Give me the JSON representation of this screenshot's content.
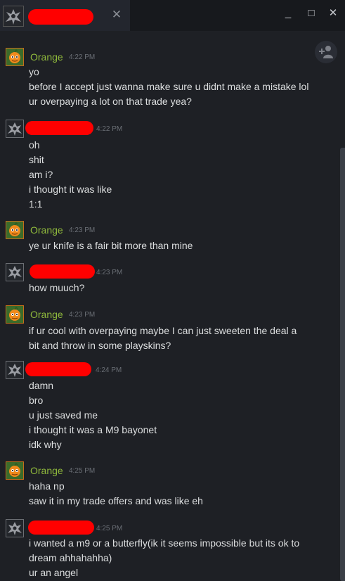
{
  "window": {
    "tab_close": "✕",
    "minimize": "_",
    "maximize": "□",
    "close": "✕"
  },
  "add_friend_icon": "person-plus-icon",
  "colors": {
    "accent_name": "#90ba3c",
    "redaction": "#ff0000",
    "background": "#1e2025"
  },
  "messages": [
    {
      "sender": "Orange",
      "time": "4:22 PM",
      "lines": [
        "yo",
        "before I accept just wanna make sure u didnt make a mistake lol",
        "ur overpaying a lot on that trade yea?"
      ]
    },
    {
      "sender": "",
      "time": "4:22 PM",
      "lines": [
        "oh",
        "shit",
        "am i?",
        "i thought it was like",
        "1:1"
      ]
    },
    {
      "sender": "Orange",
      "time": "4:23 PM",
      "lines": [
        "ye ur knife is a fair bit more than mine"
      ]
    },
    {
      "sender": "",
      "time": "4:23 PM",
      "lines": [
        "how muuch?"
      ]
    },
    {
      "sender": "Orange",
      "time": "4:23 PM",
      "lines": [
        "if ur cool with overpaying maybe I can just sweeten the deal a",
        "bit and throw in some playskins?"
      ]
    },
    {
      "sender": "",
      "time": "4:24 PM",
      "lines": [
        "damn",
        "bro",
        "u just saved me",
        "i thought it was a M9 bayonet",
        "idk why"
      ]
    },
    {
      "sender": "Orange",
      "time": "4:25 PM",
      "lines": [
        "haha np",
        "saw it in my trade offers and was like eh"
      ]
    },
    {
      "sender": "",
      "time": "4:25 PM",
      "lines": [
        "i wanted a m9 or a butterfly(ik it seems impossible but its ok to",
        "dream ahhahahha)",
        "ur an angel"
      ]
    }
  ]
}
